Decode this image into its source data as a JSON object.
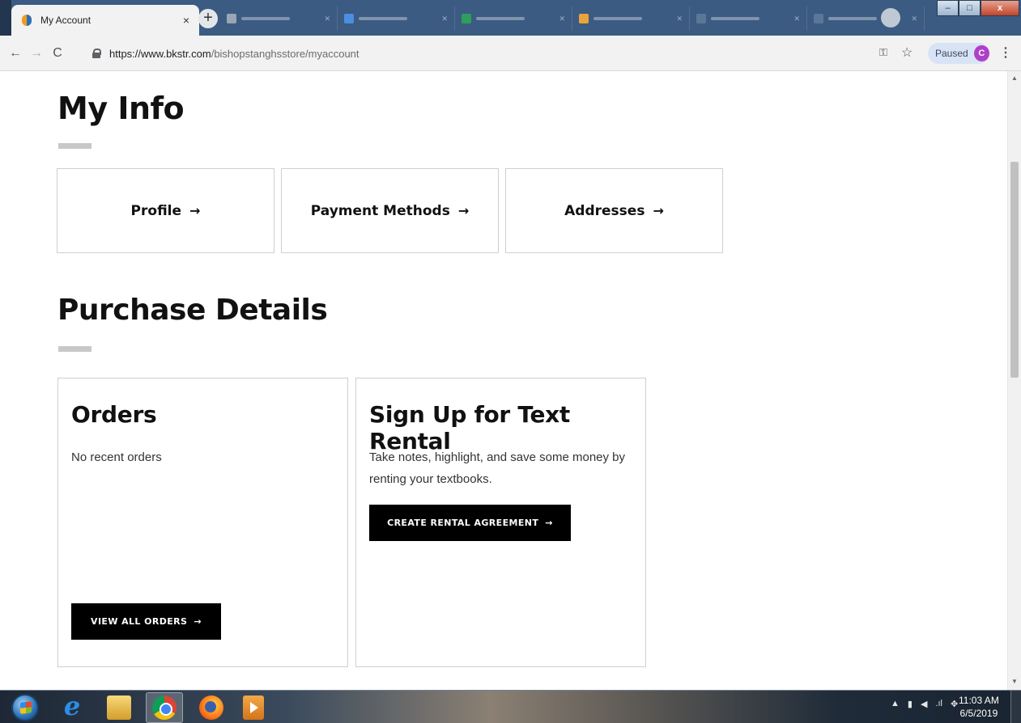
{
  "browser": {
    "active_tab": {
      "title": "My Account",
      "close": "×"
    },
    "new_tab": "+",
    "nav": {
      "back": "←",
      "forward": "→",
      "reload": "C"
    },
    "url": {
      "host": "https://www.bkstr.com",
      "path": "/bishopstanghsstore/myaccount"
    },
    "key": "⚿",
    "star": "☆",
    "profile": {
      "status": "Paused",
      "initial": "C"
    },
    "menu": "⋮",
    "window_controls": {
      "minimize": "–",
      "maximize": "□",
      "close": "x"
    }
  },
  "page": {
    "my_info": {
      "title": "My Info",
      "cards": [
        {
          "label": "Profile",
          "arrow": "→"
        },
        {
          "label": "Payment Methods",
          "arrow": "→"
        },
        {
          "label": "Addresses",
          "arrow": "→"
        }
      ]
    },
    "purchase_details": {
      "title": "Purchase Details",
      "orders": {
        "heading": "Orders",
        "text": "No recent orders",
        "button": "VIEW ALL ORDERS",
        "button_arrow": "→"
      },
      "rental": {
        "heading": "Sign Up for Text Rental",
        "text": "Take notes, highlight, and save some money by renting your textbooks.",
        "button": "CREATE RENTAL AGREEMENT",
        "button_arrow": "→"
      }
    }
  },
  "taskbar": {
    "ie_glyph": "e",
    "tray": {
      "expand": "▲",
      "signal": ".ıl",
      "dropbox": "✥"
    },
    "clock": {
      "time": "11:03 AM",
      "date": "6/5/2019"
    }
  },
  "scrollbar": {
    "up": "▲",
    "down": "▼"
  }
}
